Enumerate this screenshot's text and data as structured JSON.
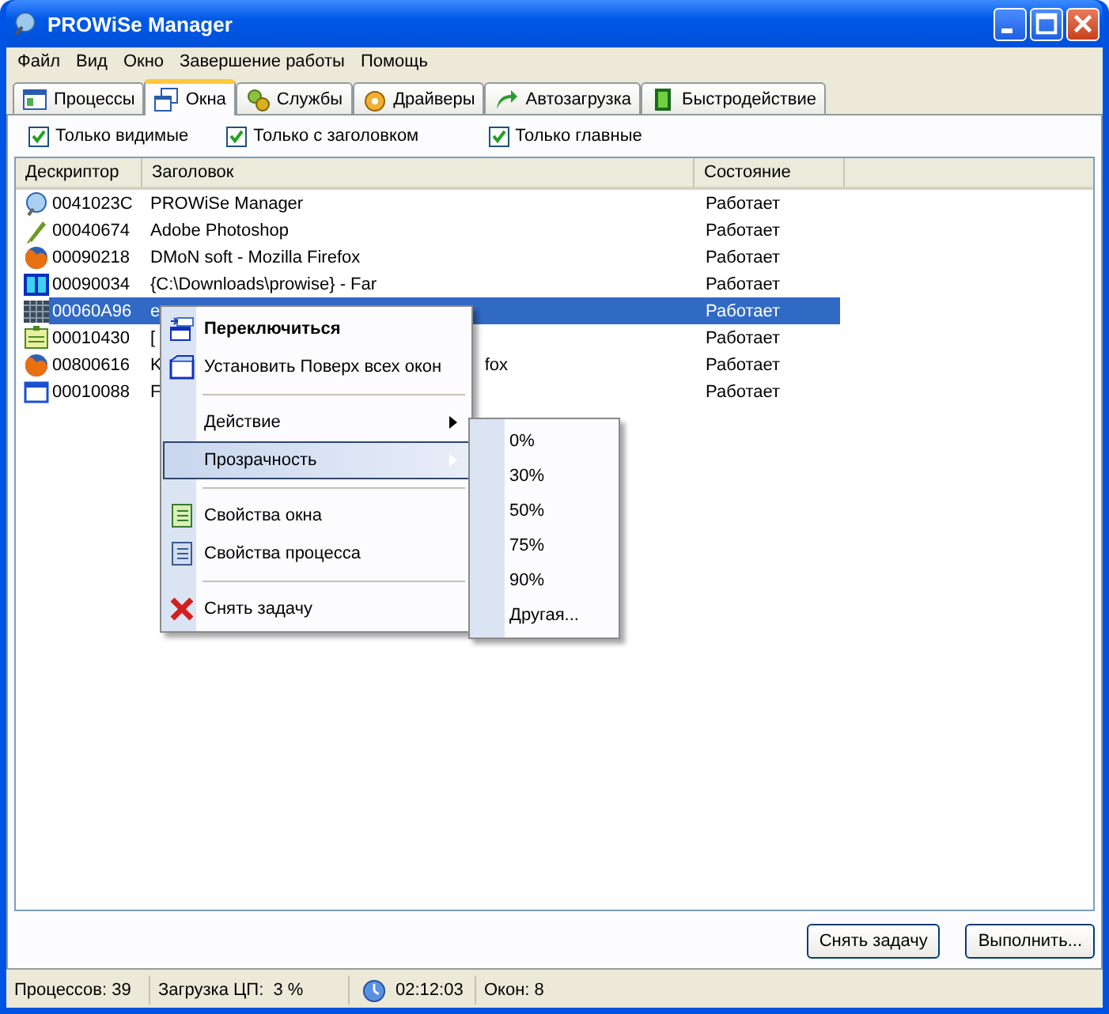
{
  "window": {
    "title": "PROWiSe Manager"
  },
  "menu_bar": [
    "Файл",
    "Вид",
    "Окно",
    "Завершение работы",
    "Помощь"
  ],
  "tabs": [
    {
      "label": "Процессы",
      "selected": false
    },
    {
      "label": "Окна",
      "selected": true
    },
    {
      "label": "Службы",
      "selected": false
    },
    {
      "label": "Драйверы",
      "selected": false
    },
    {
      "label": "Автозагрузка",
      "selected": false
    },
    {
      "label": "Быстродействие",
      "selected": false
    }
  ],
  "filters": [
    {
      "label": "Только видимые",
      "checked": true
    },
    {
      "label": "Только с заголовком",
      "checked": true
    },
    {
      "label": "Только главные",
      "checked": true
    }
  ],
  "table": {
    "columns": [
      "Дескриптор",
      "Заголовок",
      "Состояние"
    ],
    "rows": [
      {
        "handle": "0041023C",
        "title": "PROWiSe Manager",
        "state": "Работает",
        "selected": false
      },
      {
        "handle": "00040674",
        "title": "Adobe Photoshop",
        "state": "Работает",
        "selected": false
      },
      {
        "handle": "00090218",
        "title": "DMoN soft - Mozilla Firefox",
        "state": "Работает",
        "selected": false
      },
      {
        "handle": "00090034",
        "title": "{C:\\Downloads\\prowise} - Far",
        "state": "Работает",
        "selected": false
      },
      {
        "handle": "00060A96",
        "title": "e",
        "state": "Работает",
        "selected": true
      },
      {
        "handle": "00010430",
        "title": "[",
        "state": "Работает",
        "selected": false
      },
      {
        "handle": "00800616",
        "title": "K",
        "title_tail": "fox",
        "state": "Работает",
        "selected": false
      },
      {
        "handle": "00010088",
        "title": "F",
        "state": "Работает",
        "selected": false
      }
    ]
  },
  "context_menu": {
    "items": [
      {
        "kind": "item",
        "label": "Переключиться",
        "default": true,
        "selected": false
      },
      {
        "kind": "item",
        "label": "Установить Поверх всех окон",
        "default": false,
        "selected": false
      },
      {
        "kind": "separator"
      },
      {
        "kind": "submenu",
        "label": "Действие",
        "selected": false
      },
      {
        "kind": "submenu",
        "label": "Прозрачность",
        "selected": true
      },
      {
        "kind": "separator"
      },
      {
        "kind": "item",
        "label": "Свойства окна",
        "default": false,
        "selected": false
      },
      {
        "kind": "item",
        "label": "Свойства процесса",
        "default": false,
        "selected": false
      },
      {
        "kind": "separator"
      },
      {
        "kind": "item",
        "label": "Снять задачу",
        "default": false,
        "selected": false
      }
    ]
  },
  "submenu": {
    "items": [
      "0%",
      "30%",
      "50%",
      "75%",
      "90%",
      "Другая..."
    ]
  },
  "buttons": [
    "Снять задачу",
    "Выполнить..."
  ],
  "status_bar": {
    "processes": "Процессов: 39",
    "cpu": "Загрузка ЦП:  3 %",
    "time": "02:12:03",
    "windows": "Окон: 8"
  }
}
